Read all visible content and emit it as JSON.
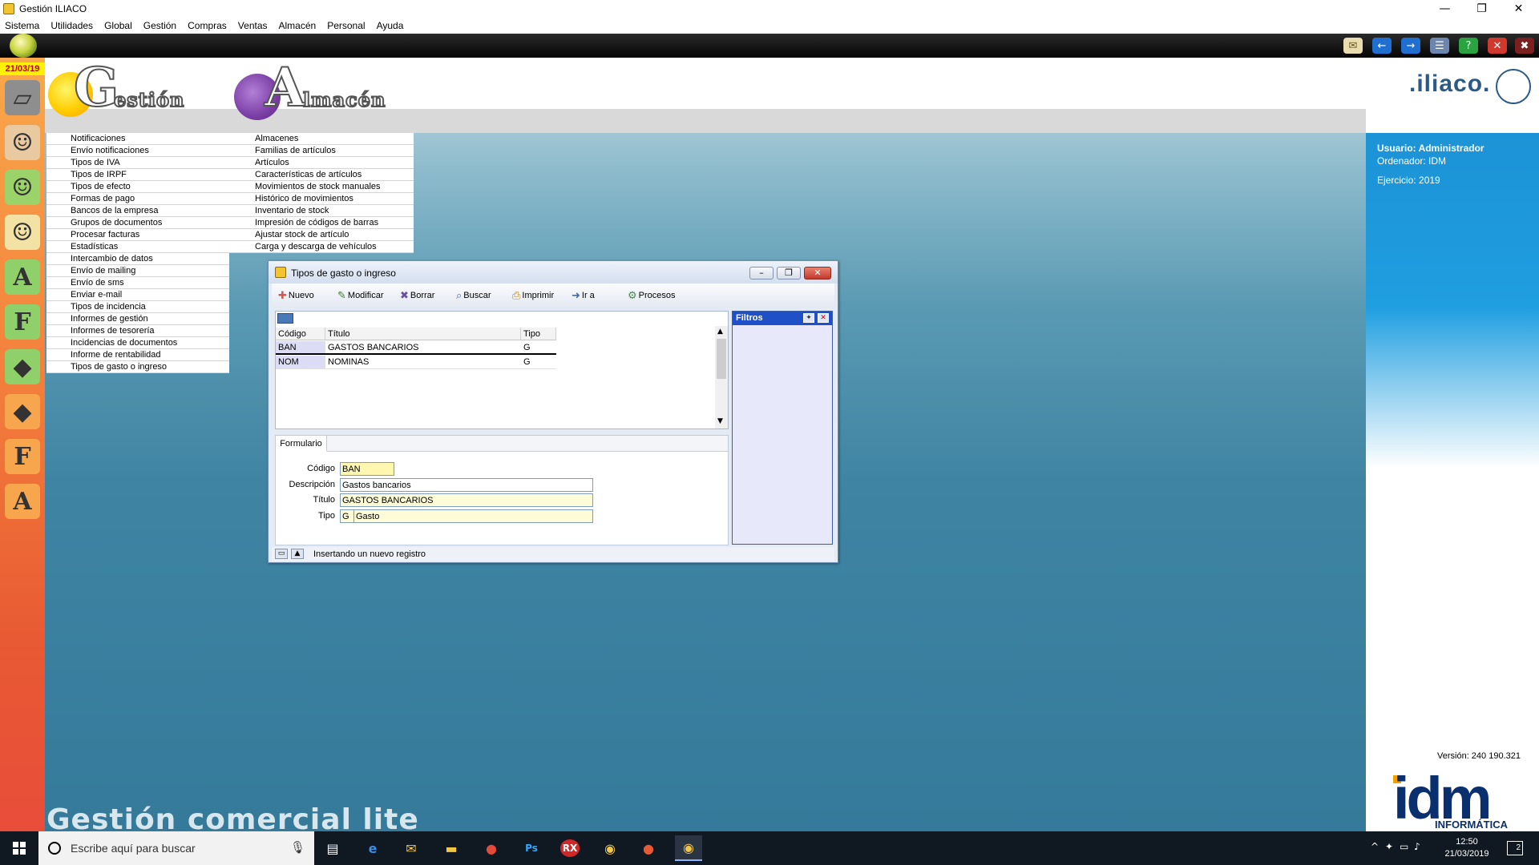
{
  "window": {
    "title": "Gestión ILIACO",
    "minimize": "—",
    "restore": "❐",
    "close": "✕"
  },
  "menubar": [
    "Sistema",
    "Utilidades",
    "Global",
    "Gestión",
    "Compras",
    "Ventas",
    "Almacén",
    "Personal",
    "Ayuda"
  ],
  "sidebar": {
    "date": "21/03/19",
    "icons": [
      {
        "name": "notebook-icon",
        "glyph": "▱",
        "color": "#8e8e8e"
      },
      {
        "name": "users-icon",
        "glyph": "☺",
        "color": "#e8c9a0"
      },
      {
        "name": "user-icon",
        "glyph": "☺",
        "color": "#9bd36a"
      },
      {
        "name": "user-search-icon",
        "glyph": "☺",
        "color": "#f2e2a4"
      },
      {
        "name": "letter-a-icon",
        "glyph": "A",
        "color": "#8fd06a"
      },
      {
        "name": "letter-f-icon",
        "glyph": "F",
        "color": "#8fd06a"
      },
      {
        "name": "shopping-bag-green-icon",
        "glyph": "◆",
        "color": "#8fd06a"
      },
      {
        "name": "shopping-bag-orange-icon",
        "glyph": "◆",
        "color": "#f8a64d"
      },
      {
        "name": "letter-f-orange-icon",
        "glyph": "F",
        "color": "#f8a64d"
      },
      {
        "name": "letter-a-orange-icon",
        "glyph": "A",
        "color": "#f8a64d"
      }
    ]
  },
  "logos": {
    "gestion_initial": "G",
    "gestion_rest": "estión",
    "almacen_initial": "A",
    "almacen_rest": "lmacén",
    "brand": ".iliaco."
  },
  "menu_gestion": [
    "Notificaciones",
    "Envío notificaciones",
    "Tipos de IVA",
    "Tipos de IRPF",
    "Tipos de efecto",
    "Formas de pago",
    "Bancos de la empresa",
    "Grupos de documentos",
    "Procesar facturas",
    "Estadísticas",
    "Intercambio de datos",
    "Envío de mailing",
    "Envío de sms",
    "Enviar e-mail",
    "Tipos de incidencia",
    "Informes de gestión",
    "Informes de tesorería",
    "Incidencias de documentos",
    "Informe de rentabilidad",
    "Tipos de gasto o ingreso"
  ],
  "menu_almacen": [
    "Almacenes",
    "Familias de artículos",
    "Artículos",
    "Características de artículos",
    "Movimientos de stock manuales",
    "Histórico de movimientos",
    "Inventario de stock",
    "Impresión de códigos de barras",
    "Ajustar stock de artículo",
    "Carga y descarga de vehículos"
  ],
  "info": {
    "usuario": "Usuario: Administrador",
    "ordenador": "Ordenador:  IDM",
    "ejercicio": "Ejercicio: 2019",
    "version": "Versión: 240 190.321",
    "idm": "idm",
    "idm_sub": "INFORMÁTICA"
  },
  "footer_title": "Gestión comercial lite",
  "dialog": {
    "title": "Tipos de gasto o ingreso",
    "toolbar": [
      {
        "name": "nuevo-button",
        "label": "Nuevo",
        "icon": "✚",
        "color": "#d9534f"
      },
      {
        "name": "modificar-button",
        "label": "Modificar",
        "icon": "✎",
        "color": "#3a7d2a"
      },
      {
        "name": "borrar-button",
        "label": "Borrar",
        "icon": "✖",
        "color": "#6a4ea0"
      },
      {
        "name": "buscar-button",
        "label": "Buscar",
        "icon": "⌕",
        "color": "#4a6a9a"
      },
      {
        "name": "imprimir-button",
        "label": "Imprimir",
        "icon": "⎙",
        "color": "#b8862b"
      },
      {
        "name": "ir-a-button",
        "label": "Ir a",
        "icon": "➜",
        "color": "#4a6a9a"
      },
      {
        "name": "procesos-button",
        "label": "Procesos",
        "icon": "⚙",
        "color": "#4a8a4a"
      }
    ],
    "grid": {
      "columns": [
        "Código",
        "Título",
        "Tipo"
      ],
      "rows": [
        [
          "BAN",
          "GASTOS BANCARIOS",
          "G"
        ],
        [
          "NOM",
          "NOMINAS",
          "G"
        ]
      ]
    },
    "filters_title": "Filtros",
    "form_tab": "Formulario",
    "form": {
      "codigo_label": "Código",
      "codigo_value": "BAN",
      "descripcion_label": "Descripción",
      "descripcion_value": "Gastos bancarios",
      "titulo_label": "Título",
      "titulo_value": "GASTOS BANCARIOS",
      "tipo_label": "Tipo",
      "tipo_code": "G",
      "tipo_value": "Gasto"
    },
    "status": "Insertando un nuevo registro"
  },
  "taskbar": {
    "search_placeholder": "Escribe aquí para buscar",
    "time": "12:50",
    "date": "21/03/2019",
    "notifications": "2"
  }
}
